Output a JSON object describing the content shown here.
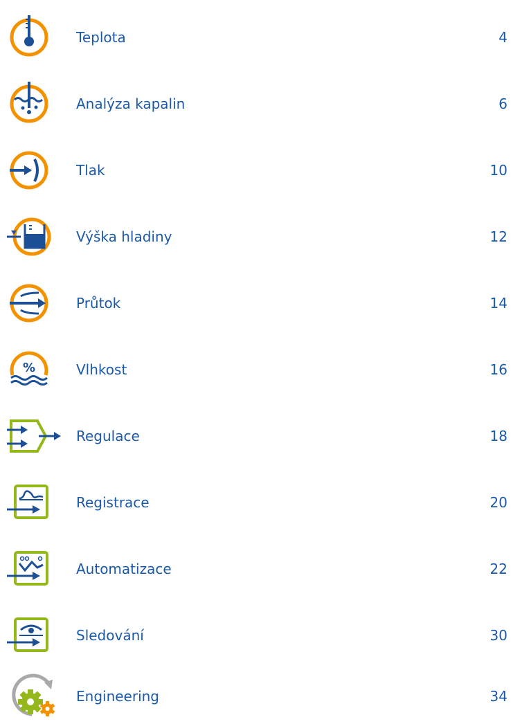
{
  "colors": {
    "orange": "#f39200",
    "blue": "#1c4f96",
    "green": "#94b81c",
    "text": "#1c5aa6",
    "gray": "#a9a9a9"
  },
  "toc": [
    {
      "label": "Teplota",
      "page": "4",
      "icon": "thermometer-icon"
    },
    {
      "label": "Analýza kapalin",
      "page": "6",
      "icon": "liquid-analysis-icon"
    },
    {
      "label": "Tlak",
      "page": "10",
      "icon": "pressure-icon"
    },
    {
      "label": "Výška hladiny",
      "page": "12",
      "icon": "level-icon"
    },
    {
      "label": "Průtok",
      "page": "14",
      "icon": "flow-icon"
    },
    {
      "label": "Vlhkost",
      "page": "16",
      "icon": "humidity-icon"
    },
    {
      "label": "Regulace",
      "page": "18",
      "icon": "control-icon"
    },
    {
      "label": "Registrace",
      "page": "20",
      "icon": "recording-icon"
    },
    {
      "label": "Automatizace",
      "page": "22",
      "icon": "automation-icon"
    },
    {
      "label": "Sledování",
      "page": "30",
      "icon": "monitoring-icon"
    },
    {
      "label": "Engineering",
      "page": "34",
      "icon": "engineering-icon"
    }
  ]
}
